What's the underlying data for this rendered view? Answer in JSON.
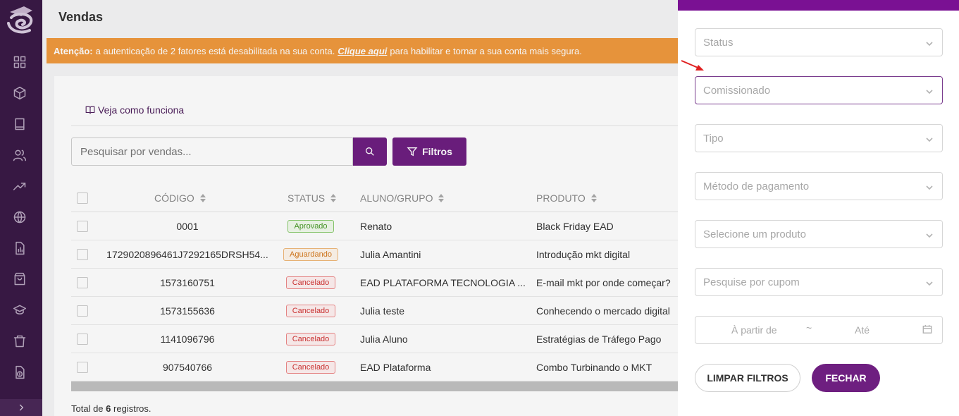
{
  "page": {
    "title": "Vendas",
    "alert": {
      "label": "Atenção:",
      "text_before": "a autenticação de 2 fatores está desabilitada na sua conta.",
      "link": "Clique aqui",
      "text_after": "para habilitar e tornar a sua conta mais segura."
    },
    "how_it_works": "Veja como funciona",
    "search": {
      "placeholder": "Pesquisar por vendas..."
    },
    "filters_button": "Filtros",
    "table": {
      "columns": [
        "CÓDIGO",
        "STATUS",
        "ALUNO/GRUPO",
        "PRODUTO"
      ],
      "rows": [
        {
          "code": "0001",
          "status": "Aprovado",
          "status_type": "aprovado",
          "aluno": "Renato",
          "produto": "Black Friday EAD"
        },
        {
          "code": "1729020896461J7292165DRSH54...",
          "status": "Aguardando",
          "status_type": "aguardando",
          "aluno": "Julia Amantini",
          "produto": "Introdução mkt digital"
        },
        {
          "code": "1573160751",
          "status": "Cancelado",
          "status_type": "cancelado",
          "aluno": "EAD PLATAFORMA TECNOLOGIA ...",
          "produto": "E-mail mkt por onde começar?"
        },
        {
          "code": "1573155636",
          "status": "Cancelado",
          "status_type": "cancelado",
          "aluno": "Julia teste",
          "produto": "Conhecendo o mercado digital"
        },
        {
          "code": "1141096796",
          "status": "Cancelado",
          "status_type": "cancelado",
          "aluno": "Julia Aluno",
          "produto": "Estratégias de Tráfego Pago"
        },
        {
          "code": "907540766",
          "status": "Cancelado",
          "status_type": "cancelado",
          "aluno": "EAD Plataforma",
          "produto": "Combo Turbinando o MKT"
        }
      ]
    },
    "total": {
      "prefix": "Total de",
      "count": "6",
      "suffix": "registros."
    }
  },
  "filter_panel": {
    "status_placeholder": "Status",
    "comissionado_placeholder": "Comissionado",
    "tipo_placeholder": "Tipo",
    "metodo_placeholder": "Método de pagamento",
    "produto_placeholder": "Selecione um produto",
    "cupom_placeholder": "Pesquise por cupom",
    "date_from": "À partir de",
    "date_separator": "~",
    "date_to": "Até",
    "clear_button": "LIMPAR FILTROS",
    "close_button": "FECHAR"
  },
  "colors": {
    "sidebar": "#3a1946",
    "primary": "#6e1f80",
    "alert": "#f09a3e",
    "panel_top": "#7a1193"
  },
  "icons": {
    "sidebar": [
      "grid-icon",
      "box-icon",
      "book-icon",
      "users-icon",
      "trending-up-icon",
      "globe-icon",
      "report-icon",
      "bag-icon",
      "graduation-cap-icon",
      "trash-icon",
      "file-dollar-icon"
    ]
  }
}
